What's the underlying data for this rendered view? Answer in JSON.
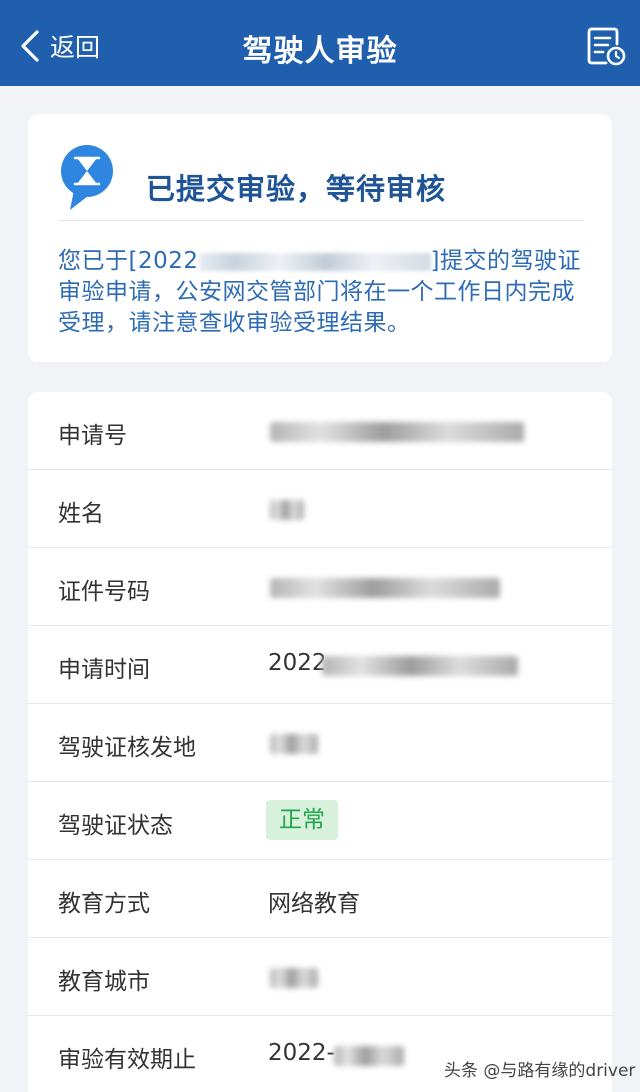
{
  "nav": {
    "back_label": "返回",
    "title": "驾驶人审验",
    "record_icon": "document-clock-icon"
  },
  "status": {
    "icon": "hourglass-chat-icon",
    "title": "已提交审验，等待审核",
    "desc_prefix": "您已于[2022",
    "desc_suffix": "]提交的驾驶证审验申请，公安网交管部门将在一个工作日内完成受理，请注意查收审验受理结果。"
  },
  "info": {
    "rows": [
      {
        "label": "申请号",
        "value": ""
      },
      {
        "label": "姓名",
        "value": ""
      },
      {
        "label": "证件号码",
        "value": ""
      },
      {
        "label": "申请时间",
        "value": "2022"
      },
      {
        "label": "驾驶证核发地",
        "value": ""
      },
      {
        "label": "驾驶证状态",
        "value": "正常"
      },
      {
        "label": "教育方式",
        "value": "网络教育"
      },
      {
        "label": "教育城市",
        "value": ""
      },
      {
        "label": "审验有效期止",
        "value": "2022-"
      }
    ]
  },
  "watermark": "头条 @与路有缘的driver",
  "colors": {
    "nav_bg": "#1f5fad",
    "status_title": "#1f5496",
    "status_desc": "#2e6bb5",
    "badge_bg": "#d7f1dd",
    "badge_text": "#21a64a"
  }
}
